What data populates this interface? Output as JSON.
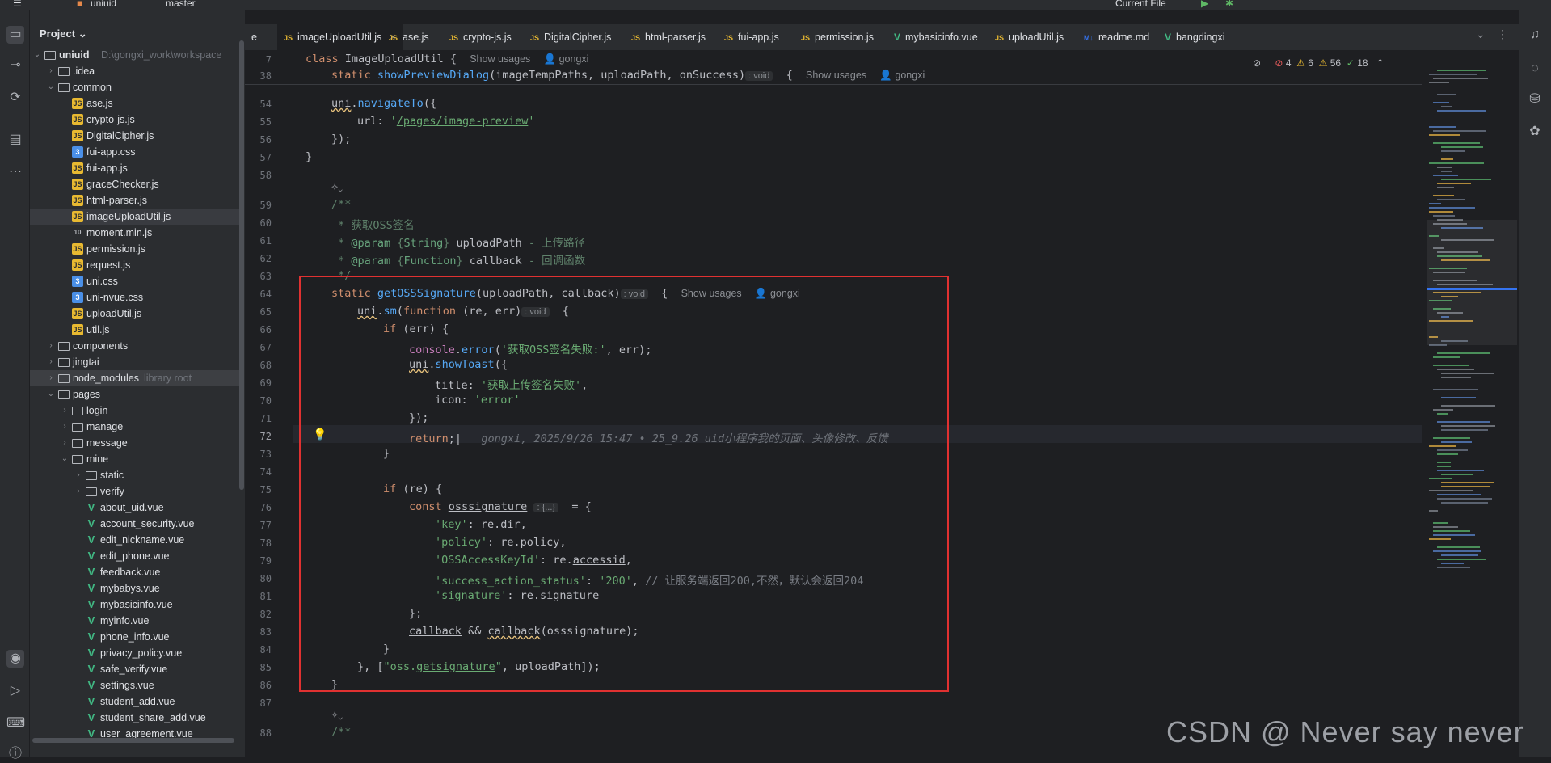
{
  "topbar": {
    "project": "uniuid",
    "branch": "master",
    "run_config": "Current File"
  },
  "toolstrip": {
    "icons": [
      "folder-icon",
      "commit-icon",
      "pull-requests-icon",
      "structure-icon",
      "more-icon",
      "ai-assistant-icon",
      "services-icon",
      "terminal-icon",
      "problems-icon"
    ]
  },
  "project_panel": {
    "title": "Project",
    "root": {
      "name": "uniuid",
      "path": "D:\\gongxi_work\\workspace"
    },
    "rows": [
      {
        "label": "uniuid",
        "sub": "D:\\gongxi_work\\workspace",
        "depth": 0,
        "type": "folder",
        "open": true
      },
      {
        "label": ".idea",
        "depth": 1,
        "type": "folder",
        "open": false
      },
      {
        "label": "common",
        "depth": 1,
        "type": "folder",
        "open": true
      },
      {
        "label": "ase.js",
        "depth": 2,
        "type": "js"
      },
      {
        "label": "crypto-js.js",
        "depth": 2,
        "type": "js"
      },
      {
        "label": "DigitalCipher.js",
        "depth": 2,
        "type": "js"
      },
      {
        "label": "fui-app.css",
        "depth": 2,
        "type": "css"
      },
      {
        "label": "fui-app.js",
        "depth": 2,
        "type": "js"
      },
      {
        "label": "graceChecker.js",
        "depth": 2,
        "type": "js"
      },
      {
        "label": "html-parser.js",
        "depth": 2,
        "type": "js"
      },
      {
        "label": "imageUploadUtil.js",
        "depth": 2,
        "type": "js",
        "selected": true
      },
      {
        "label": "moment.min.js",
        "depth": 2,
        "type": "num"
      },
      {
        "label": "permission.js",
        "depth": 2,
        "type": "js"
      },
      {
        "label": "request.js",
        "depth": 2,
        "type": "js"
      },
      {
        "label": "uni.css",
        "depth": 2,
        "type": "css"
      },
      {
        "label": "uni-nvue.css",
        "depth": 2,
        "type": "css"
      },
      {
        "label": "uploadUtil.js",
        "depth": 2,
        "type": "js"
      },
      {
        "label": "util.js",
        "depth": 2,
        "type": "js"
      },
      {
        "label": "components",
        "depth": 1,
        "type": "folder",
        "open": false
      },
      {
        "label": "jingtai",
        "depth": 1,
        "type": "folder",
        "open": false
      },
      {
        "label": "node_modules",
        "sub": "library root",
        "depth": 1,
        "type": "folder",
        "open": false,
        "hl": true
      },
      {
        "label": "pages",
        "depth": 1,
        "type": "folder",
        "open": true
      },
      {
        "label": "login",
        "depth": 2,
        "type": "folder",
        "open": false
      },
      {
        "label": "manage",
        "depth": 2,
        "type": "folder",
        "open": false
      },
      {
        "label": "message",
        "depth": 2,
        "type": "folder",
        "open": false
      },
      {
        "label": "mine",
        "depth": 2,
        "type": "folder",
        "open": true
      },
      {
        "label": "static",
        "depth": 3,
        "type": "folder",
        "open": false
      },
      {
        "label": "verify",
        "depth": 3,
        "type": "folder",
        "open": false
      },
      {
        "label": "about_uid.vue",
        "depth": 3,
        "type": "vue"
      },
      {
        "label": "account_security.vue",
        "depth": 3,
        "type": "vue"
      },
      {
        "label": "edit_nickname.vue",
        "depth": 3,
        "type": "vue"
      },
      {
        "label": "edit_phone.vue",
        "depth": 3,
        "type": "vue"
      },
      {
        "label": "feedback.vue",
        "depth": 3,
        "type": "vue"
      },
      {
        "label": "mybabys.vue",
        "depth": 3,
        "type": "vue"
      },
      {
        "label": "mybasicinfo.vue",
        "depth": 3,
        "type": "vue"
      },
      {
        "label": "myinfo.vue",
        "depth": 3,
        "type": "vue"
      },
      {
        "label": "phone_info.vue",
        "depth": 3,
        "type": "vue"
      },
      {
        "label": "privacy_policy.vue",
        "depth": 3,
        "type": "vue"
      },
      {
        "label": "safe_verify.vue",
        "depth": 3,
        "type": "vue"
      },
      {
        "label": "settings.vue",
        "depth": 3,
        "type": "vue"
      },
      {
        "label": "student_add.vue",
        "depth": 3,
        "type": "vue"
      },
      {
        "label": "student_share_add.vue",
        "depth": 3,
        "type": "vue"
      },
      {
        "label": "user_agreement.vue",
        "depth": 3,
        "type": "vue"
      }
    ]
  },
  "tabs": [
    {
      "label": "e",
      "type": "none"
    },
    {
      "label": "imageUploadUtil.js",
      "type": "js",
      "active": true
    },
    {
      "label": "ase.js",
      "type": "js"
    },
    {
      "label": "crypto-js.js",
      "type": "js"
    },
    {
      "label": "DigitalCipher.js",
      "type": "js"
    },
    {
      "label": "html-parser.js",
      "type": "js"
    },
    {
      "label": "fui-app.js",
      "type": "js"
    },
    {
      "label": "permission.js",
      "type": "js"
    },
    {
      "label": "mybasicinfo.vue",
      "type": "vue"
    },
    {
      "label": "uploadUtil.js",
      "type": "js"
    },
    {
      "label": "readme.md",
      "type": "md"
    },
    {
      "label": "bangdingxi",
      "type": "vue"
    }
  ],
  "indicators": {
    "errors": "4",
    "warnings": "6",
    "weak_warnings": "56",
    "ok": "18"
  },
  "editor": {
    "sticky": [
      {
        "ln": "7",
        "text": "class ImageUploadUtil {",
        "hint": "Show usages",
        "author": "gongxi"
      },
      {
        "ln": "38",
        "text": "static showPreviewDialog(imageTempPaths, uploadPath, onSuccess)",
        "inlay": ": void",
        "hint": "Show usages",
        "author": "gongxi"
      }
    ],
    "blame": "gongxi, 2025/9/26 15:47 • 25_9.26 uid小程序我的页面、头像修改、反馈",
    "show_usages": "Show usages",
    "author": "gongxi"
  },
  "watermark": "CSDN @      Never say never"
}
